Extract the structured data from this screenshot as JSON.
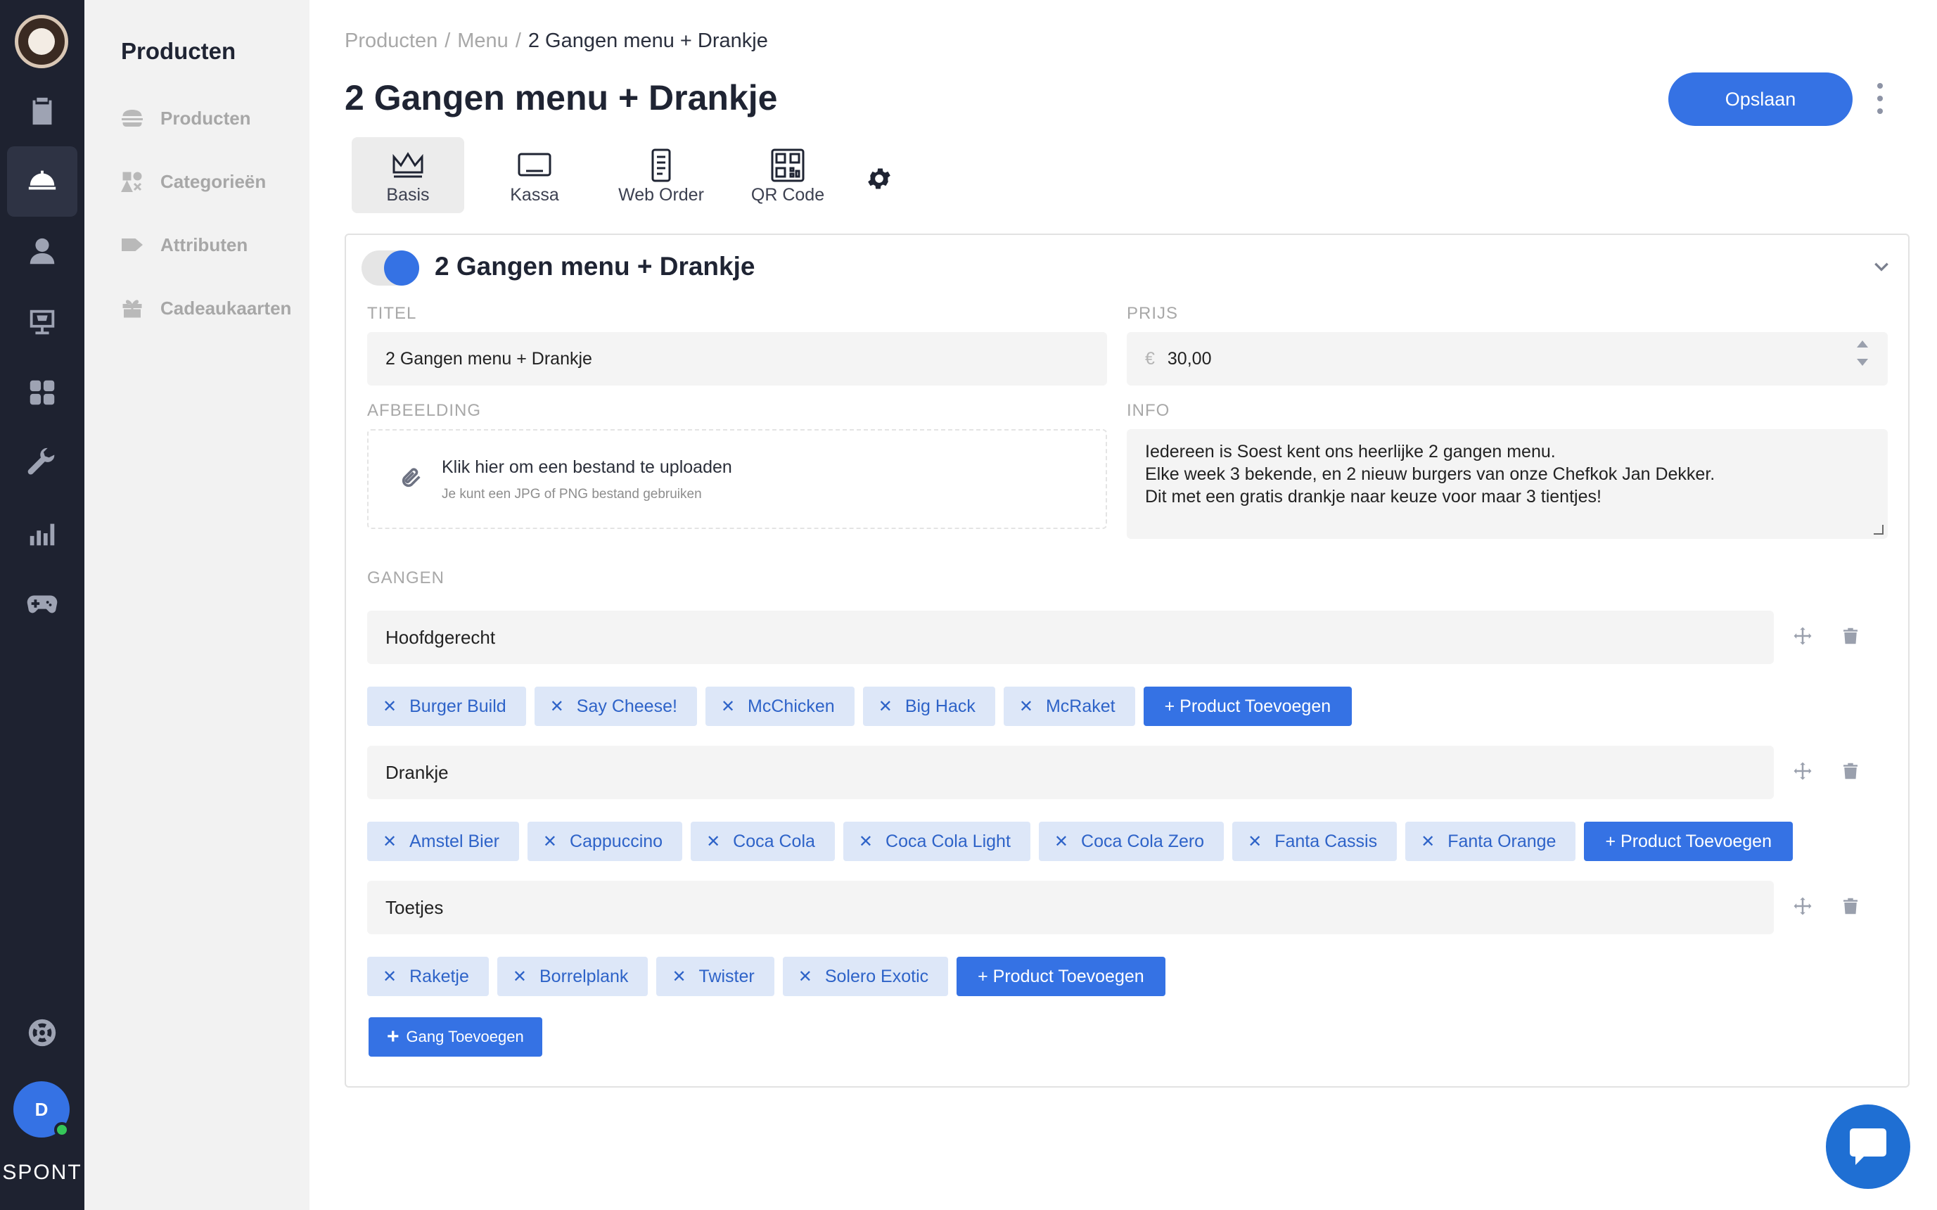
{
  "rail": {
    "items": [
      {
        "icon": "clipboard-icon"
      },
      {
        "icon": "cloche-icon",
        "active": true
      },
      {
        "icon": "user-icon"
      },
      {
        "icon": "kiosk-icon"
      },
      {
        "icon": "grid-icon"
      },
      {
        "icon": "wrench-icon"
      },
      {
        "icon": "bar-chart-icon"
      },
      {
        "icon": "gamepad-icon"
      },
      {
        "icon": "lifebuoy-icon"
      }
    ],
    "avatar_initial": "D",
    "brand": "SPONT"
  },
  "subnav": {
    "title": "Producten",
    "items": [
      {
        "label": "Producten",
        "icon": "burger-icon"
      },
      {
        "label": "Categorieën",
        "icon": "categories-icon"
      },
      {
        "label": "Attributen",
        "icon": "tag-icon"
      },
      {
        "label": "Cadeaukaarten",
        "icon": "gift-icon"
      }
    ]
  },
  "breadcrumb": {
    "items": [
      "Producten",
      "Menu"
    ],
    "current": "2 Gangen menu + Drankje",
    "sep": "/"
  },
  "page": {
    "title": "2 Gangen menu + Drankje",
    "save_label": "Opslaan"
  },
  "tabs": [
    {
      "label": "Basis",
      "icon": "crown-icon",
      "active": true
    },
    {
      "label": "Kassa",
      "icon": "register-icon"
    },
    {
      "label": "Web Order",
      "icon": "document-icon"
    },
    {
      "label": "QR Code",
      "icon": "qr-code-icon"
    }
  ],
  "card": {
    "title": "2 Gangen menu + Drankje",
    "enabled": true,
    "titel_label": "TITEL",
    "titel_value": "2 Gangen menu + Drankje",
    "prijs_label": "PRIJS",
    "prijs_currency": "€",
    "prijs_value": "30,00",
    "afbeelding_label": "AFBEELDING",
    "upload_title": "Klik hier om een bestand te uploaden",
    "upload_hint": "Je kunt een JPG of PNG bestand gebruiken",
    "info_label": "INFO",
    "info_lines": [
      "Iedereen is Soest kent ons heerlijke 2 gangen menu.",
      "Elke week 3 bekende, en 2 nieuw burgers van onze Chefkok Jan Dekker.",
      "Dit met een gratis drankje naar keuze voor maar 3 tientjes!"
    ],
    "gangen_label": "GANGEN",
    "add_product_label": "+ Product Toevoegen",
    "add_gang_label": "Gang Toevoegen",
    "chip_remove": "✕",
    "gangen": [
      {
        "name": "Hoofdgerecht",
        "products": [
          "Burger Build",
          "Say Cheese!",
          "McChicken",
          "Big Hack",
          "McRaket"
        ]
      },
      {
        "name": "Drankje",
        "products": [
          "Amstel Bier",
          "Cappuccino",
          "Coca Cola",
          "Coca Cola Light",
          "Coca Cola Zero",
          "Fanta Cassis",
          "Fanta Orange"
        ]
      },
      {
        "name": "Toetjes",
        "products": [
          "Raketje",
          "Borrelplank",
          "Twister",
          "Solero Exotic"
        ]
      }
    ]
  },
  "colors": {
    "accent": "#3572e4",
    "rail": "#1e2230",
    "chip_bg": "#dde7f8",
    "chip_text": "#2e63c8"
  }
}
